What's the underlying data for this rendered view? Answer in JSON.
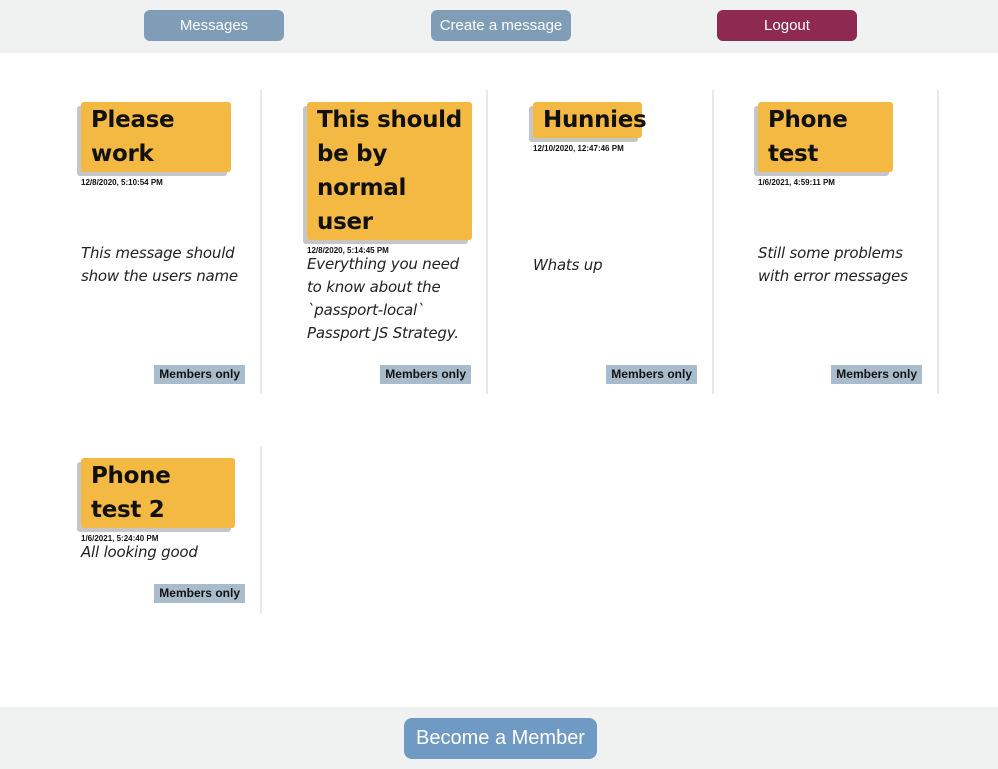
{
  "nav": {
    "messages_label": "Messages",
    "create_label": "Create a message",
    "logout_label": "Logout"
  },
  "messages": [
    {
      "title": "Please work",
      "date": "12/8/2020, 5:10:54 PM",
      "body": "This message should show the users name",
      "badge": "Members only"
    },
    {
      "title": "This should be by normal user",
      "date": "12/8/2020, 5:14:45 PM",
      "body": "Everything you need to know about the `passport-local` Passport JS Strategy.",
      "badge": "Members only"
    },
    {
      "title": "Hunnies",
      "date": "12/10/2020, 12:47:46 PM",
      "body": "Whats up",
      "badge": "Members only"
    },
    {
      "title": "Phone test",
      "date": "1/6/2021, 4:59:11 PM",
      "body": "Still some problems with error messages",
      "badge": "Members only"
    },
    {
      "title": "Phone test 2",
      "date": "1/6/2021, 5:24:40 PM",
      "body": "All looking good",
      "badge": "Members only"
    }
  ],
  "footer": {
    "member_label": "Become a Member"
  },
  "colors": {
    "nav_button": "#7f9db6",
    "logout_button": "#8e2a52",
    "title_bg": "#f4b942",
    "badge_bg": "#a9bccb",
    "member_button": "#6f9ac3"
  }
}
